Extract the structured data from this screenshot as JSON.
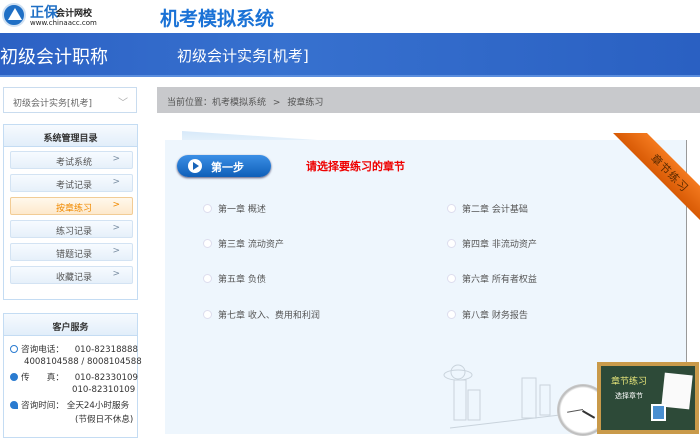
{
  "header": {
    "logo_brand": "正保",
    "logo_sub": "会计网校",
    "logo_url": "www.chinaacc.com",
    "title": "机考模拟系统"
  },
  "banner": {
    "category": "初级会计职称",
    "subject": "初级会计实务[机考]"
  },
  "subject_select": {
    "value": "初级会计实务[机考]"
  },
  "breadcrumb": {
    "prefix": "当前位置：",
    "items": [
      "机考模拟系统",
      "按章练习"
    ],
    "sep": ">"
  },
  "sidebar": {
    "title": "系统管理目录",
    "items": [
      {
        "label": "考试系统"
      },
      {
        "label": "考试记录"
      },
      {
        "label": "按章练习",
        "active": true
      },
      {
        "label": "练习记录"
      },
      {
        "label": "错题记录"
      },
      {
        "label": "收藏记录"
      }
    ]
  },
  "service": {
    "title": "客户服务",
    "phone_label": "咨询电话：",
    "phone1": "010-82318888",
    "phone2": "4008104588 / 8008104588",
    "fax_label": "传　　真：",
    "fax1": "010-82330109",
    "fax2": "010-82310109",
    "time_label": "咨询时间：",
    "time": "全天24小时服务",
    "time_note": "(节假日不休息)"
  },
  "main": {
    "step_label": "第一步",
    "prompt": "请选择要练习的章节",
    "ribbon": "章节练习",
    "chapters": [
      "第一章 概述",
      "第二章 会计基础",
      "第三章 流动资产",
      "第四章 非流动资产",
      "第五章 负债",
      "第六章 所有者权益",
      "第七章 收入、费用和利润",
      "第八章 财务报告"
    ]
  },
  "board": {
    "title": "章节练习",
    "subtitle": "选择章节"
  },
  "colors": {
    "brand_blue": "#2c61c4",
    "accent_orange": "#f08a00",
    "prompt_red": "#e00000"
  }
}
